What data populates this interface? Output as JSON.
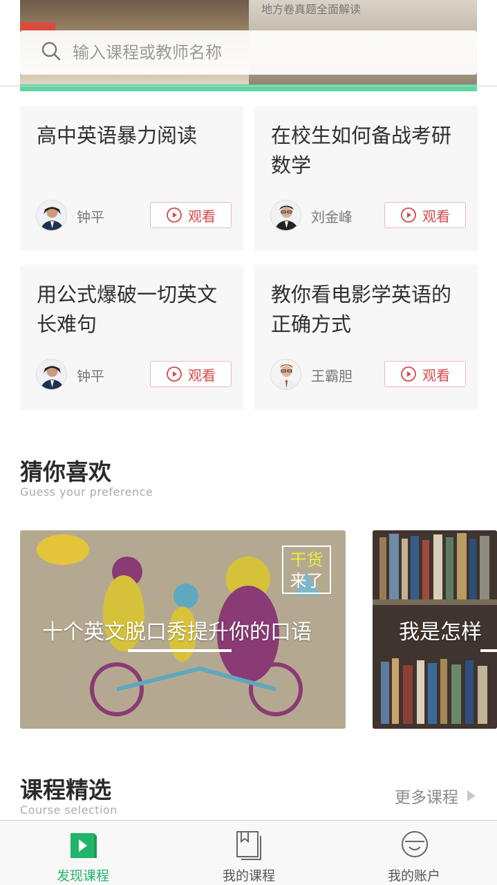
{
  "search": {
    "placeholder": "输入课程或教师名称",
    "icon": "search-icon"
  },
  "banner": {
    "partial_text": "地方卷真题全面解读"
  },
  "courses": [
    {
      "title": "高中英语暴力阅读",
      "teacher": "钟平",
      "watch_label": "观看"
    },
    {
      "title": "在校生如何备战考研数学",
      "teacher": "刘金峰",
      "watch_label": "观看"
    },
    {
      "title": "用公式爆破一切英文长难句",
      "teacher": "钟平",
      "watch_label": "观看"
    },
    {
      "title": "教你看电影学英语的正确方式",
      "teacher": "王霸胆",
      "watch_label": "观看"
    }
  ],
  "guess": {
    "title": "猜你喜欢",
    "subtitle": "Guess your preference",
    "items": [
      {
        "title": "十个英文脱口秀提升你的口语",
        "tag_line1": "干货",
        "tag_line2": "来了"
      },
      {
        "title": "我是怎样"
      }
    ]
  },
  "selection": {
    "title": "课程精选",
    "subtitle": "Course selection",
    "more_label": "更多课程"
  },
  "tabbar": {
    "tabs": [
      {
        "label": "发现课程",
        "icon": "discover-courses-icon",
        "active": true
      },
      {
        "label": "我的课程",
        "icon": "my-courses-icon",
        "active": false
      },
      {
        "label": "我的账户",
        "icon": "my-account-icon",
        "active": false
      }
    ]
  },
  "colors": {
    "accent_green": "#21b46a",
    "watch_red": "#d54848",
    "card_bg": "#f7f7f7"
  }
}
